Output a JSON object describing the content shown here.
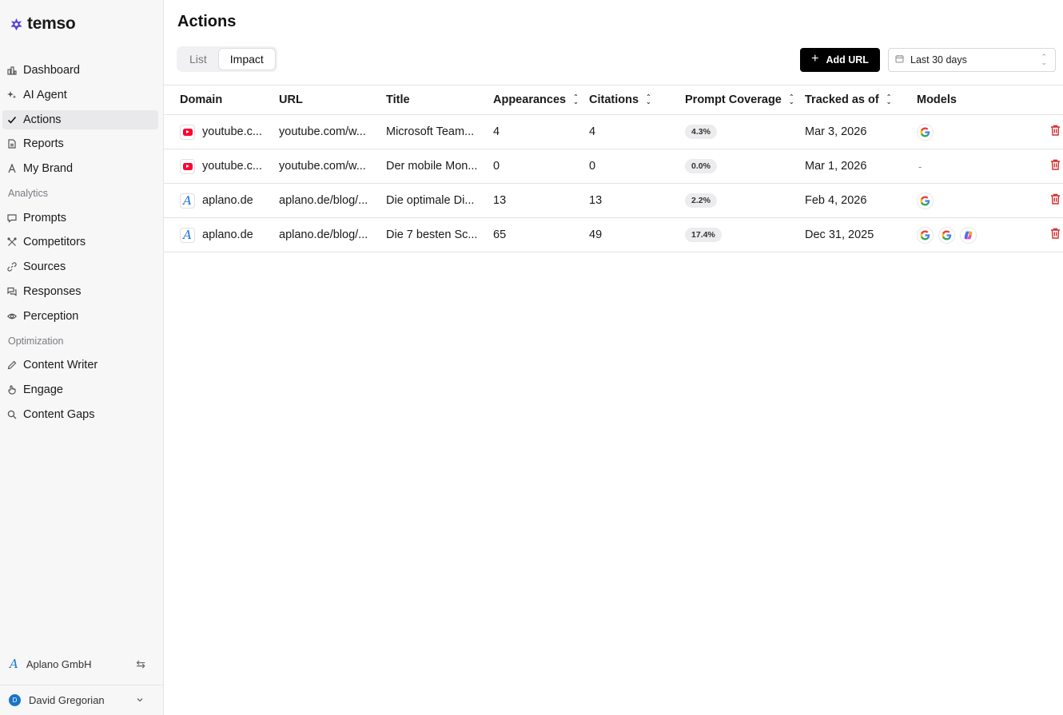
{
  "app": {
    "name": "temso"
  },
  "sidebar": {
    "items": [
      {
        "label": "Dashboard",
        "icon": "dashboard-icon"
      },
      {
        "label": "AI Agent",
        "icon": "sparkle-icon"
      },
      {
        "label": "Actions",
        "icon": "check-icon",
        "active": true
      },
      {
        "label": "Reports",
        "icon": "report-icon"
      },
      {
        "label": "My Brand",
        "icon": "brand-icon"
      }
    ],
    "analytics_label": "Analytics",
    "analytics": [
      {
        "label": "Prompts",
        "icon": "chat-icon"
      },
      {
        "label": "Competitors",
        "icon": "competitors-icon"
      },
      {
        "label": "Sources",
        "icon": "link-icon"
      },
      {
        "label": "Responses",
        "icon": "responses-icon"
      },
      {
        "label": "Perception",
        "icon": "eye-icon"
      }
    ],
    "optimization_label": "Optimization",
    "optimization": [
      {
        "label": "Content Writer",
        "icon": "pencil-icon"
      },
      {
        "label": "Engage",
        "icon": "hand-icon"
      },
      {
        "label": "Content Gaps",
        "icon": "search-icon"
      }
    ],
    "org": "Aplano GmbH",
    "user": {
      "name": "David Gregorian",
      "initial": "D"
    }
  },
  "page": {
    "title": "Actions",
    "tabs": [
      {
        "label": "List"
      },
      {
        "label": "Impact",
        "active": true
      }
    ],
    "add_button": "Add URL",
    "date_range": "Last 30 days"
  },
  "table": {
    "headers": {
      "domain": "Domain",
      "url": "URL",
      "title": "Title",
      "appearances": "Appearances",
      "citations": "Citations",
      "coverage": "Prompt Coverage",
      "tracked": "Tracked as of",
      "models": "Models"
    },
    "rows": [
      {
        "domain": "youtube.c...",
        "site": "youtube",
        "url": "youtube.com/w...",
        "title": "Microsoft Team...",
        "appearances": "4",
        "citations": "4",
        "coverage": "4.3%",
        "tracked": "Mar 3, 2026",
        "models": [
          "google"
        ]
      },
      {
        "domain": "youtube.c...",
        "site": "youtube",
        "url": "youtube.com/w...",
        "title": "Der mobile Mon...",
        "appearances": "0",
        "citations": "0",
        "coverage": "0.0%",
        "tracked": "Mar 1, 2026",
        "models": [],
        "models_empty": "-"
      },
      {
        "domain": "aplano.de",
        "site": "aplano",
        "url": "aplano.de/blog/...",
        "title": "Die optimale Di...",
        "appearances": "13",
        "citations": "13",
        "coverage": "2.2%",
        "tracked": "Feb 4, 2026",
        "models": [
          "google"
        ]
      },
      {
        "domain": "aplano.de",
        "site": "aplano",
        "url": "aplano.de/blog/...",
        "title": "Die 7 besten Sc...",
        "appearances": "65",
        "citations": "49",
        "coverage": "17.4%",
        "tracked": "Dec 31, 2025",
        "models": [
          "google",
          "google",
          "copilot"
        ]
      }
    ]
  },
  "colors": {
    "brand": "#5b3fd6",
    "delete": "#d32f2f",
    "youtube": "#ff0033",
    "aplano": "#1976d2"
  }
}
